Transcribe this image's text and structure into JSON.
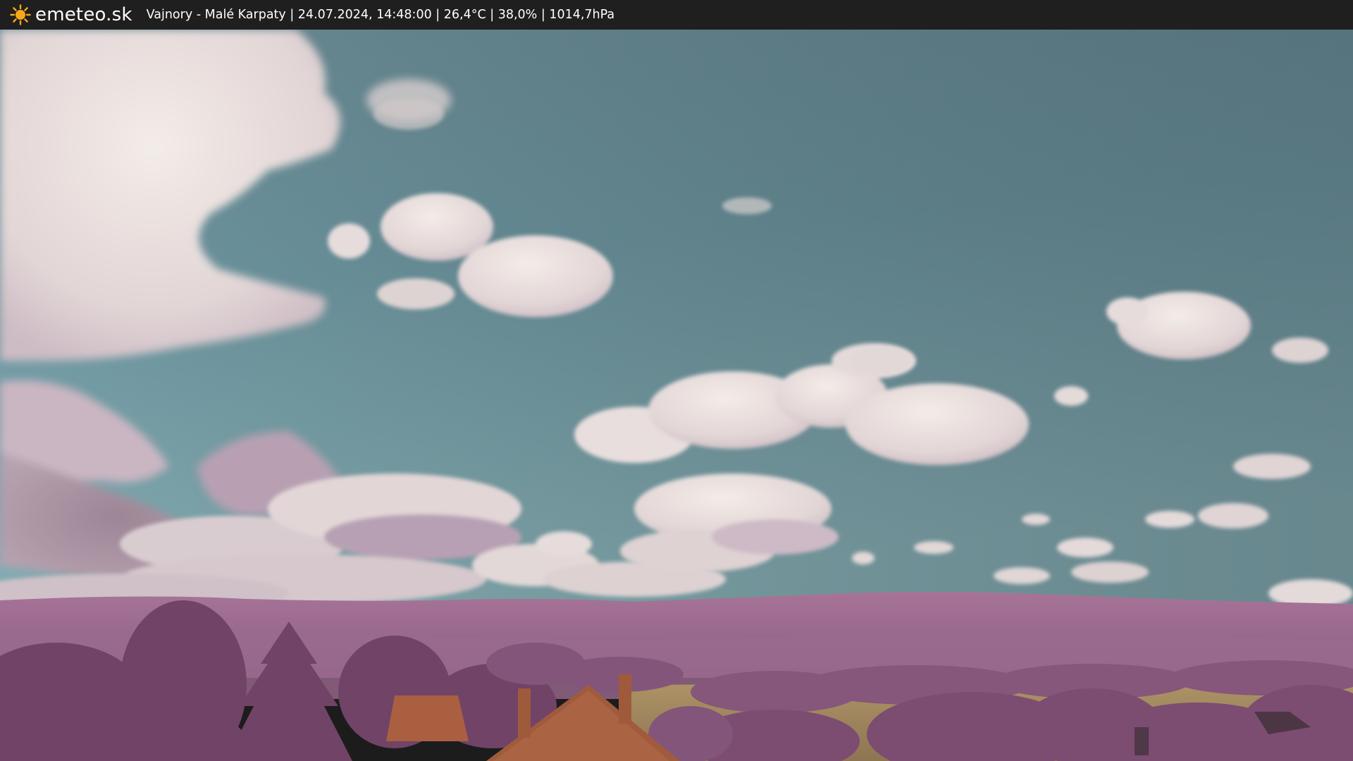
{
  "header": {
    "brand_name": "emeteo.sk",
    "brand_icon": "sun-icon",
    "caption": "Vajnory - Malé Karpaty | 24.07.2024, 14:48:00 | 26,4°C | 38,0% | 1014,7hPa"
  },
  "colors": {
    "header_bg": "#1f1f1f",
    "sun": "#f7a81a",
    "sky_top": "#58707a",
    "sky_bottom": "#7fa9b1",
    "hills": "#9c6a90",
    "trees": "#7e4e72",
    "roof": "#a5603f",
    "field": "#a48a5e"
  }
}
